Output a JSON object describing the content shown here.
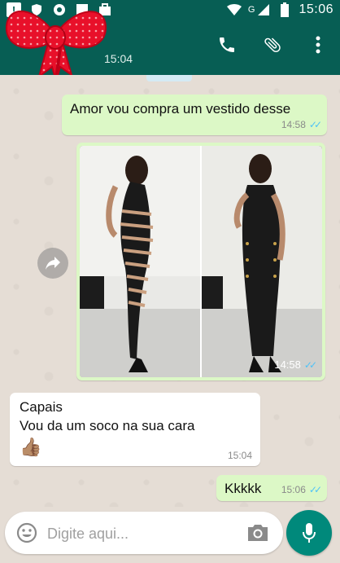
{
  "status_bar": {
    "time": "15:06",
    "network_type": "G",
    "icons": [
      "alert-icon",
      "shield-icon",
      "settings-icon",
      "box-icon",
      "briefcase-icon",
      "wifi-icon",
      "signal-icon",
      "battery-icon"
    ]
  },
  "header": {
    "last_seen": "15:04",
    "actions": [
      "phone-icon",
      "attach-icon",
      "more-icon"
    ]
  },
  "messages": [
    {
      "direction": "out",
      "text": "Amor vou compra um vestido desse",
      "time": "14:58",
      "read": true
    },
    {
      "direction": "out",
      "type": "image",
      "time": "14:58",
      "read": true
    },
    {
      "direction": "in",
      "line1": "Capais",
      "line2": "Vou da um soco na sua cara",
      "emoji": "👍🏽",
      "time": "15:04"
    },
    {
      "direction": "out",
      "text": "Kkkkk",
      "time": "15:06",
      "read": true
    }
  ],
  "input": {
    "placeholder": "Digite aqui..."
  },
  "colors": {
    "header": "#075e54",
    "outgoing_bubble": "#dcf8c6",
    "incoming_bubble": "#ffffff",
    "mic_button": "#00897b",
    "read_ticks": "#4fc3f7"
  }
}
